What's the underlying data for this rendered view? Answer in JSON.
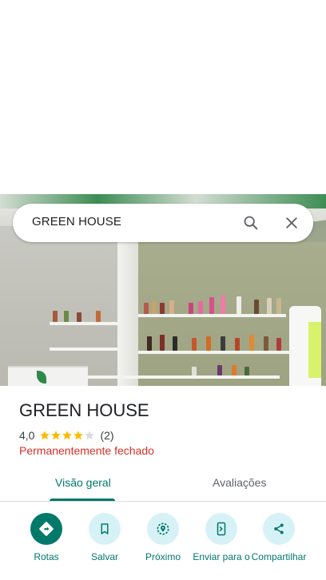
{
  "search": {
    "query": "GREEN HOUSE",
    "search_icon": "search-icon",
    "clear_icon": "close-icon"
  },
  "place": {
    "name": "GREEN HOUSE",
    "rating": "4,0",
    "rating_value": 4,
    "rating_max": 5,
    "review_count": "(2)",
    "status": "Permanentemente fechado",
    "status_color": "#d93025"
  },
  "tabs": [
    {
      "label": "Visão geral",
      "active": true
    },
    {
      "label": "Avaliações",
      "active": false
    }
  ],
  "actions": [
    {
      "label": "Rotas",
      "icon": "directions-icon"
    },
    {
      "label": "Salvar",
      "icon": "bookmark-icon"
    },
    {
      "label": "Próximo",
      "icon": "nearby-icon"
    },
    {
      "label": "Enviar para o",
      "icon": "send-to-phone-icon"
    },
    {
      "label": "Compartilhar",
      "icon": "share-icon"
    }
  ],
  "colors": {
    "accent": "#00796b",
    "action_bg": "#d7f2f7",
    "star": "#fbbc04"
  }
}
